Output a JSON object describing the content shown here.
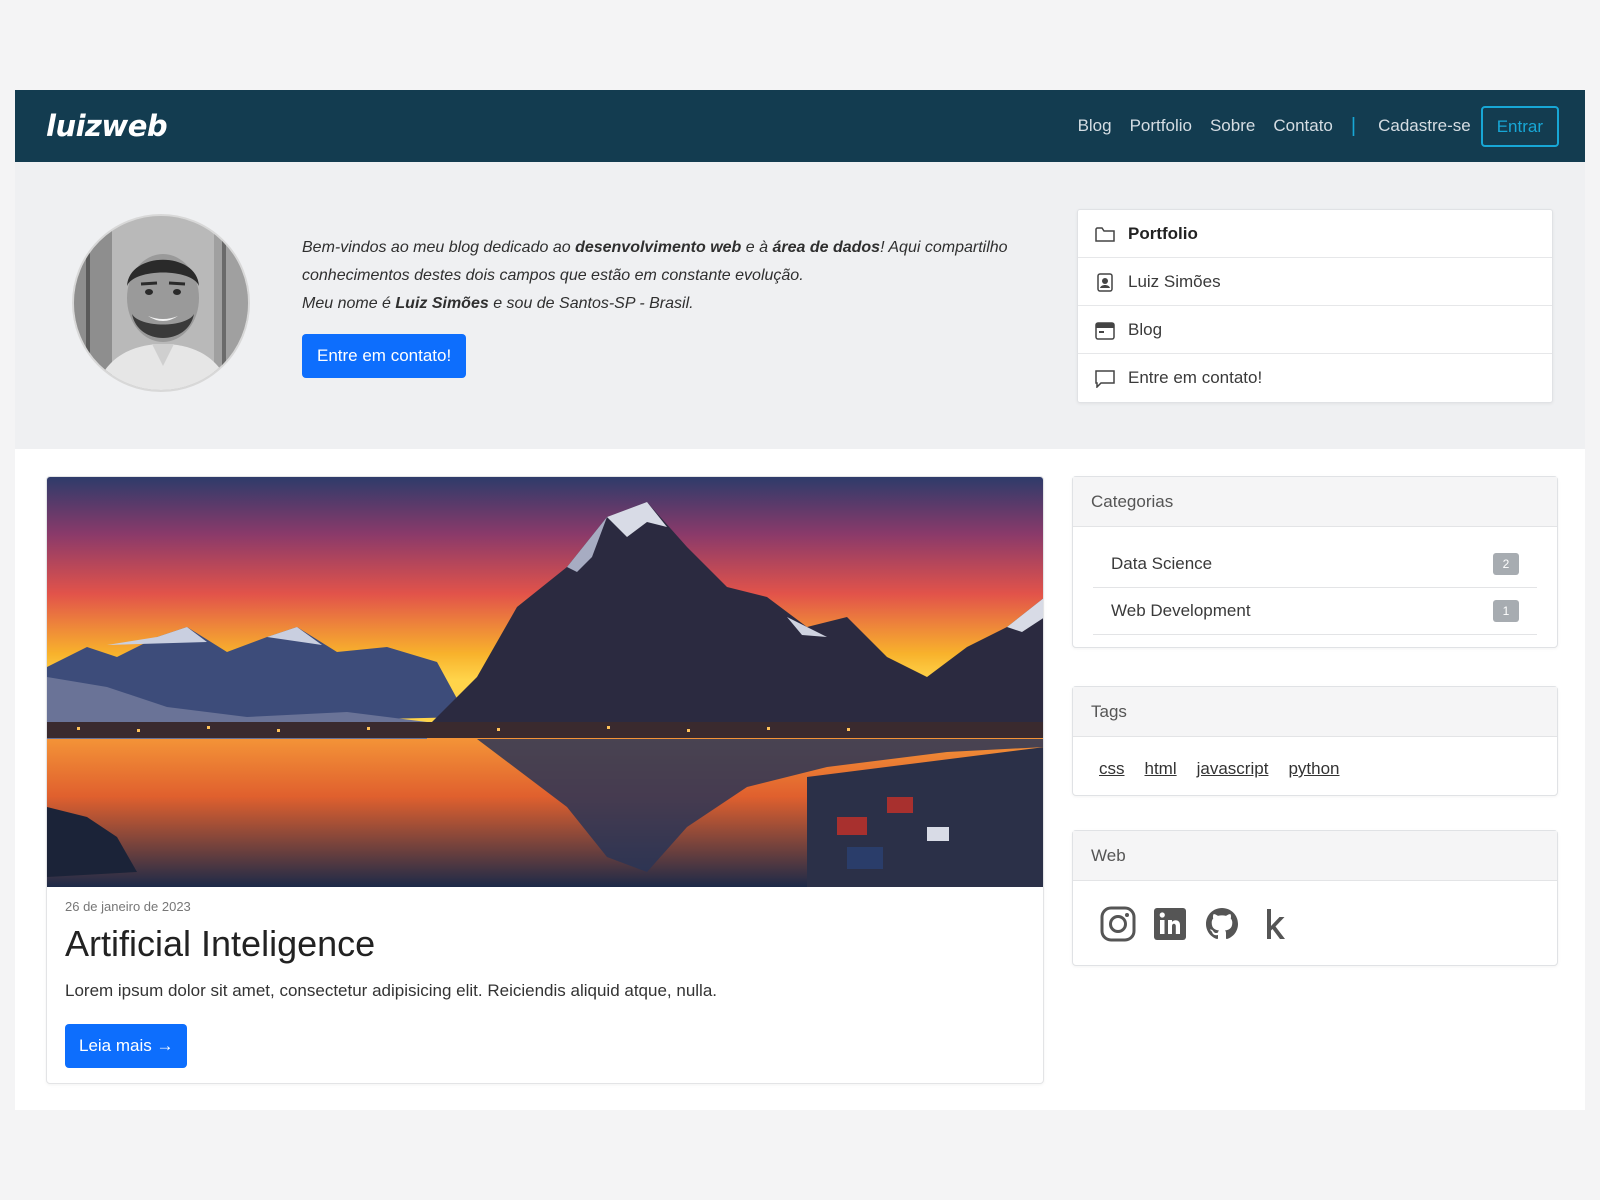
{
  "navbar": {
    "brand": "luizweb",
    "links": [
      "Blog",
      "Portfolio",
      "Sobre",
      "Contato"
    ],
    "separator": "|",
    "signup": "Cadastre-se",
    "login": "Entrar"
  },
  "hero": {
    "intro_part1": "Bem-vindos ao meu blog dedicado ao ",
    "intro_bold1": "desenvolvimento web",
    "intro_part2": " e à ",
    "intro_bold2": "área de dados",
    "intro_part3": "! Aqui compartilho conhecimentos destes dois campos que estão em constante evolução.",
    "intro_line2_part1": "Meu nome é ",
    "intro_line2_bold": "Luiz Simões",
    "intro_line2_part2": " e sou de Santos-SP - Brasil.",
    "cta": "Entre em contato!",
    "quicklinks": [
      {
        "label": "Portfolio",
        "icon": "folder-icon"
      },
      {
        "label": "Luiz Simões",
        "icon": "person-badge-icon"
      },
      {
        "label": "Blog",
        "icon": "calendar-icon"
      },
      {
        "label": "Entre em contato!",
        "icon": "chat-icon"
      }
    ]
  },
  "post": {
    "date": "26 de janeiro de 2023",
    "title": "Artificial Inteligence",
    "excerpt": "Lorem ipsum dolor sit amet, consectetur adipisicing elit. Reiciendis aliquid atque, nulla.",
    "read_more": "Leia mais →"
  },
  "sidebar": {
    "categories": {
      "title": "Categorias",
      "items": [
        {
          "label": "Data Science",
          "count": "2"
        },
        {
          "label": "Web Development",
          "count": "1"
        }
      ]
    },
    "tags": {
      "title": "Tags",
      "items": [
        "css",
        "html",
        "javascript",
        "python"
      ]
    },
    "web": {
      "title": "Web",
      "icons": [
        "instagram-icon",
        "linkedin-icon",
        "github-icon",
        "kaggle-icon"
      ]
    }
  },
  "colors": {
    "navbar": "#133c50",
    "accent": "#17a7d6",
    "primary": "#0d6efd"
  }
}
